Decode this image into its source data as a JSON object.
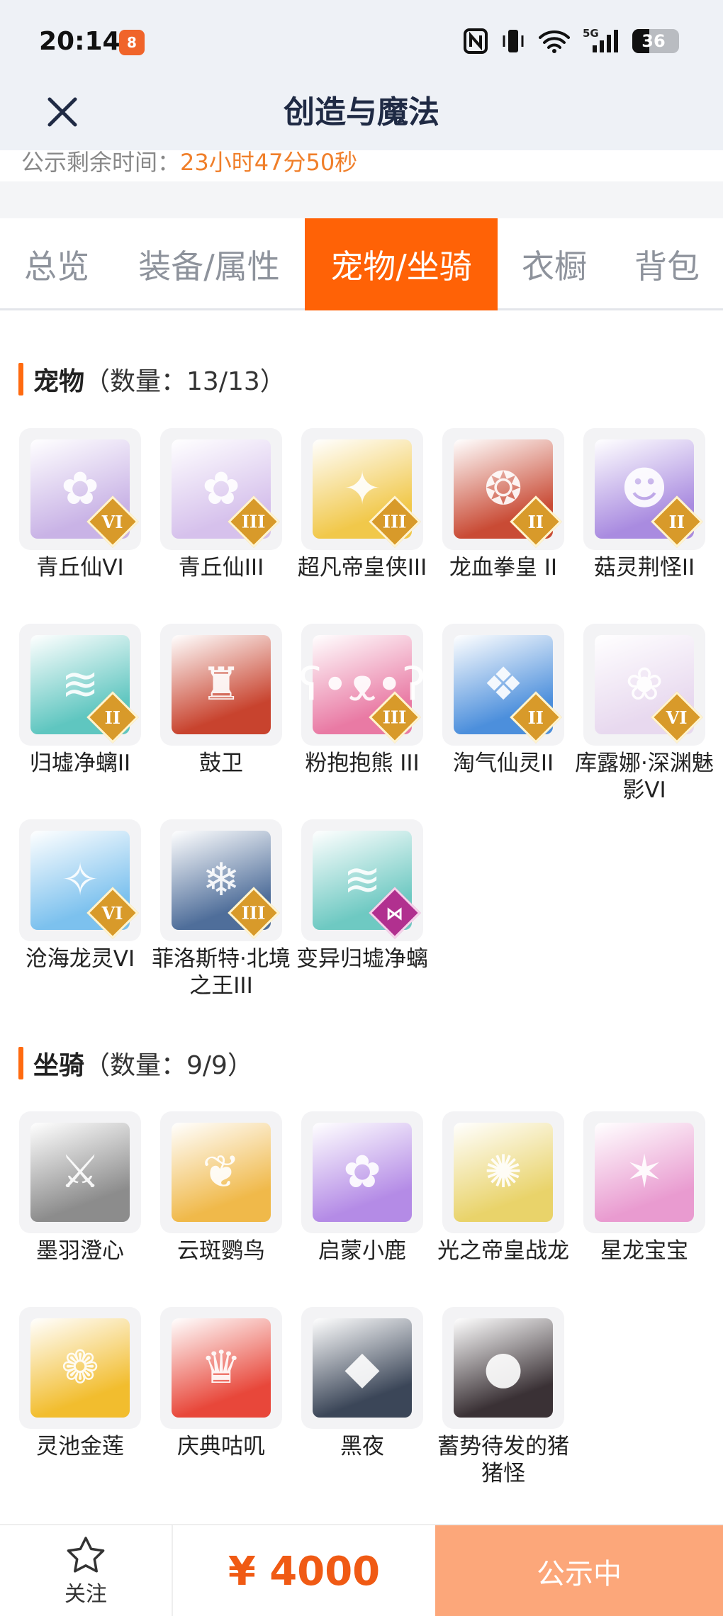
{
  "status_bar": {
    "time": "20:14",
    "app_icon_text": "8",
    "signal_label": "5G",
    "battery": "36",
    "battery_level": 0.36
  },
  "header": {
    "title": "创造与魔法",
    "close_icon": "close-icon"
  },
  "notice": {
    "label": "公示剩余时间：",
    "value": "23小时47分50秒"
  },
  "tabs": [
    {
      "label": "总览",
      "active": false
    },
    {
      "label": "装备/属性",
      "active": false
    },
    {
      "label": "宠物/坐骑",
      "active": true
    },
    {
      "label": "衣橱",
      "active": false
    },
    {
      "label": "背包",
      "active": false
    }
  ],
  "pets": {
    "title": "宠物",
    "count": "（数量：13/13）",
    "items": [
      {
        "name": "青丘仙VI",
        "badge": "VI",
        "color": "#c9b3e6",
        "glyph": "✿"
      },
      {
        "name": "青丘仙III",
        "badge": "III",
        "color": "#d6c1ec",
        "glyph": "✿"
      },
      {
        "name": "超凡帝皇侠III",
        "badge": "III",
        "color": "#f1c84a",
        "glyph": "✦"
      },
      {
        "name": "龙血拳皇 II",
        "badge": "II",
        "color": "#c94b35",
        "glyph": "❂"
      },
      {
        "name": "菇灵荆怪II",
        "badge": "II",
        "color": "#a98be0",
        "glyph": "☻"
      },
      {
        "name": "归墟净螭II",
        "badge": "II",
        "color": "#5fc6c0",
        "glyph": "≋"
      },
      {
        "name": "鼓卫",
        "badge": "",
        "color": "#c8432e",
        "glyph": "♜"
      },
      {
        "name": "粉抱抱熊 III",
        "badge": "III",
        "color": "#e97aa4",
        "glyph": "ʕ•ᴥ•ʔ"
      },
      {
        "name": "淘气仙灵II",
        "badge": "II",
        "color": "#4c8fdc",
        "glyph": "❖"
      },
      {
        "name": "库露娜·深渊魅影VI",
        "badge": "VI",
        "color": "#e8d9ef",
        "glyph": "❀"
      },
      {
        "name": "沧海龙灵VI",
        "badge": "VI",
        "color": "#7cc1ee",
        "glyph": "✧"
      },
      {
        "name": "菲洛斯特·北境之王III",
        "badge": "III",
        "color": "#4f6e9a",
        "glyph": "❄"
      },
      {
        "name": "变异归墟净螭",
        "badge": "⋈",
        "color": "#6ec9c2",
        "glyph": "≋",
        "badge_style": "purple"
      }
    ]
  },
  "mounts": {
    "title": "坐骑",
    "count": "（数量：9/9）",
    "items": [
      {
        "name": "墨羽澄心",
        "color": "#8c8c8c",
        "glyph": "⚔"
      },
      {
        "name": "云斑鹦鸟",
        "color": "#f0b94a",
        "glyph": "❦"
      },
      {
        "name": "启蒙小鹿",
        "color": "#b48be6",
        "glyph": "✿"
      },
      {
        "name": "光之帝皇战龙",
        "color": "#e9d36a",
        "glyph": "✺"
      },
      {
        "name": "星龙宝宝",
        "color": "#e99bd0",
        "glyph": "✶"
      },
      {
        "name": "灵池金莲",
        "color": "#f2bd2e",
        "glyph": "❁"
      },
      {
        "name": "庆典咕叽",
        "color": "#e8473a",
        "glyph": "♛"
      },
      {
        "name": "黑夜",
        "color": "#3b4658",
        "glyph": "◆"
      },
      {
        "name": "蓄势待发的猪猪怪",
        "color": "#3a3135",
        "glyph": "●"
      }
    ]
  },
  "bottom": {
    "follow_label": "关注",
    "price": "¥ 4000",
    "status_label": "公示中"
  }
}
